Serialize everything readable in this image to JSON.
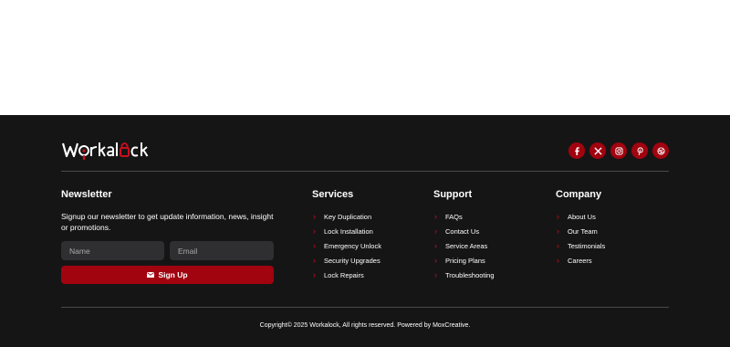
{
  "brand": {
    "logo_text": "Workalock",
    "accent": "#a1030f",
    "footer_bg": "#161516"
  },
  "social": [
    {
      "name": "facebook-icon"
    },
    {
      "name": "x-twitter-icon"
    },
    {
      "name": "instagram-icon"
    },
    {
      "name": "pinterest-icon"
    },
    {
      "name": "dribbble-icon"
    }
  ],
  "newsletter": {
    "title": "Newsletter",
    "text": "Signup our newsletter to get update information, news, insight or promotions.",
    "name_placeholder": "Name",
    "email_placeholder": "Email",
    "button_label": "Sign Up"
  },
  "services": {
    "title": "Services",
    "items": [
      "Key Duplication",
      "Lock Installation",
      "Emergency Unlock",
      "Security Upgrades",
      "Lock Repairs"
    ]
  },
  "support": {
    "title": "Support",
    "items": [
      "FAQs",
      "Contact Us",
      "Service Areas",
      "Pricing Plans",
      "Troubleshooting"
    ]
  },
  "company": {
    "title": "Company",
    "items": [
      "About Us",
      "Our Team",
      "Testimonials",
      "Careers"
    ]
  },
  "copyright": "Copyright© 2025 Workalock, All rights reserved. Powered by MoxCreative."
}
